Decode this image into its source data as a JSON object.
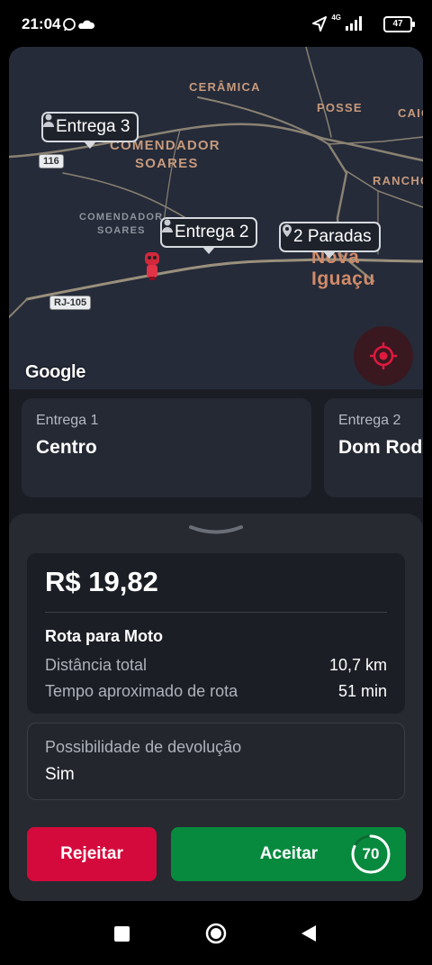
{
  "status_bar": {
    "time": "21:04",
    "network": "4G",
    "battery": "47"
  },
  "map": {
    "labels": {
      "ceramica": "CERÂMICA",
      "posse": "POSSE",
      "caic": "CAIC",
      "comendador_soares_big_1": "COMENDADOR",
      "comendador_soares_big_2": "SOARES",
      "comendador_soares_small_1": "COMENDADOR",
      "comendador_soares_small_2": "SOARES",
      "rancho": "RANCHO",
      "nova_iguacu": "Nova Iguaçu"
    },
    "shields": {
      "br116": "116",
      "rj105": "RJ-105"
    },
    "markers": {
      "delivery3": "Entrega 3",
      "delivery2": "Entrega 2",
      "stops": "2 Paradas"
    },
    "attribution": "Google"
  },
  "deliveries": [
    {
      "label": "Entrega 1",
      "title": "Centro"
    },
    {
      "label": "Entrega 2",
      "title": "Dom Rod"
    }
  ],
  "offer": {
    "price": "R$ 19,82",
    "route_title": "Rota para Moto",
    "distance_label": "Distância total",
    "distance_value": "10,7 km",
    "time_label": "Tempo aproximado de rota",
    "time_value": "51 min",
    "return_label": "Possibilidade de devolução",
    "return_value": "Sim"
  },
  "actions": {
    "reject": "Rejeitar",
    "accept": "Aceitar",
    "countdown": "70",
    "countdown_progress": 0.82
  },
  "colors": {
    "reject": "#d50a3c",
    "accept": "#078a3e",
    "locate_accent": "#e0193f"
  },
  "icons": {
    "status_whatsapp": "whatsapp-icon",
    "status_cloud": "cloud-icon",
    "status_location": "location-arrow-icon",
    "status_signal": "signal-icon",
    "marker_person": "person-icon",
    "marker_stops": "location-pin-icon",
    "locate": "my-location-icon",
    "grabber": "chevron-down-icon",
    "nav_recents": "square-icon",
    "nav_home": "circle-icon",
    "nav_back": "triangle-back-icon"
  }
}
